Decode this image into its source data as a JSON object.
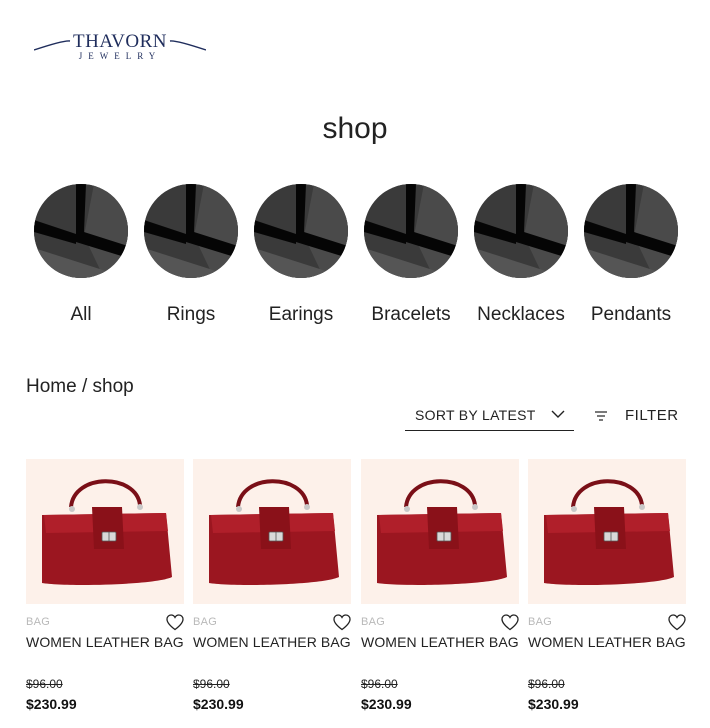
{
  "brand": {
    "name": "THAVORN",
    "sub": "JEWELRY",
    "color": "#1f2d5c"
  },
  "page": {
    "title": "shop"
  },
  "categories": [
    {
      "label": "All",
      "icon": "category-thumbnail"
    },
    {
      "label": "Rings",
      "icon": "category-thumbnail"
    },
    {
      "label": "Earings",
      "icon": "category-thumbnail"
    },
    {
      "label": "Bracelets",
      "icon": "category-thumbnail"
    },
    {
      "label": "Necklaces",
      "icon": "category-thumbnail"
    },
    {
      "label": "Pendants",
      "icon": "category-thumbnail"
    }
  ],
  "breadcrumb": {
    "home": "Home",
    "separator": "/",
    "current": "shop"
  },
  "sort": {
    "label": "SORT BY LATEST",
    "icon": "chevron-down-icon"
  },
  "filter": {
    "label": "FILTER",
    "icon": "filter-icon"
  },
  "products": [
    {
      "category": "BAG",
      "name": "WOMEN LEATHER BAG",
      "old_price": "$96.00",
      "price": "$230.99",
      "icon": "heart-icon"
    },
    {
      "category": "BAG",
      "name": "WOMEN LEATHER BAG",
      "old_price": "$96.00",
      "price": "$230.99",
      "icon": "heart-icon"
    },
    {
      "category": "BAG",
      "name": "WOMEN LEATHER BAG",
      "old_price": "$96.00",
      "price": "$230.99",
      "icon": "heart-icon"
    },
    {
      "category": "BAG",
      "name": "WOMEN LEATHER BAG",
      "old_price": "$96.00",
      "price": "$230.99",
      "icon": "heart-icon"
    }
  ],
  "colors": {
    "product_bg": "#fdf1ea",
    "bag": "#9b1620",
    "thumb": "#3c3c3c"
  }
}
